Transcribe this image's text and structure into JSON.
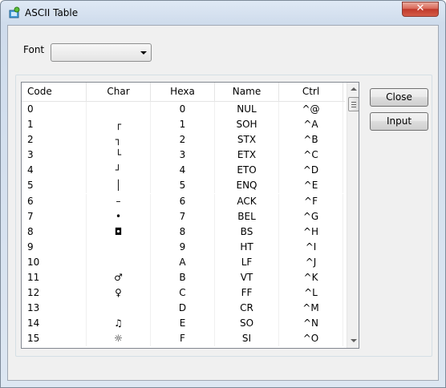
{
  "window": {
    "title": "ASCII Table",
    "close_symbol": "✕"
  },
  "font": {
    "label": "Font",
    "selected": ""
  },
  "table": {
    "columns": [
      "Code",
      "Char",
      "Hexa",
      "Name",
      "Ctrl"
    ],
    "rows": [
      {
        "code": "0",
        "char": "",
        "hexa": "0",
        "name": "NUL",
        "ctrl": "^@"
      },
      {
        "code": "1",
        "char": "┌",
        "hexa": "1",
        "name": "SOH",
        "ctrl": "^A"
      },
      {
        "code": "2",
        "char": "┐",
        "hexa": "2",
        "name": "STX",
        "ctrl": "^B"
      },
      {
        "code": "3",
        "char": "└",
        "hexa": "3",
        "name": "ETX",
        "ctrl": "^C"
      },
      {
        "code": "4",
        "char": "┘",
        "hexa": "4",
        "name": "ETO",
        "ctrl": "^D"
      },
      {
        "code": "5",
        "char": "│",
        "hexa": "5",
        "name": "ENQ",
        "ctrl": "^E"
      },
      {
        "code": "6",
        "char": "–",
        "hexa": "6",
        "name": "ACK",
        "ctrl": "^F"
      },
      {
        "code": "7",
        "char": "•",
        "hexa": "7",
        "name": "BEL",
        "ctrl": "^G"
      },
      {
        "code": "8",
        "char": "◘",
        "hexa": "8",
        "name": "BS",
        "ctrl": "^H"
      },
      {
        "code": "9",
        "char": "",
        "hexa": "9",
        "name": "HT",
        "ctrl": "^I"
      },
      {
        "code": "10",
        "char": "",
        "hexa": "A",
        "name": "LF",
        "ctrl": "^J"
      },
      {
        "code": "11",
        "char": "♂",
        "hexa": "B",
        "name": "VT",
        "ctrl": "^K"
      },
      {
        "code": "12",
        "char": "♀",
        "hexa": "C",
        "name": "FF",
        "ctrl": "^L"
      },
      {
        "code": "13",
        "char": "",
        "hexa": "D",
        "name": "CR",
        "ctrl": "^M"
      },
      {
        "code": "14",
        "char": "♫",
        "hexa": "E",
        "name": "SO",
        "ctrl": "^N"
      },
      {
        "code": "15",
        "char": "☼",
        "hexa": "F",
        "name": "SI",
        "ctrl": "^O"
      }
    ]
  },
  "buttons": {
    "close": "Close",
    "input": "Input"
  },
  "icons": {
    "app": "ascii-table-app-icon",
    "window_close": "close-icon"
  }
}
